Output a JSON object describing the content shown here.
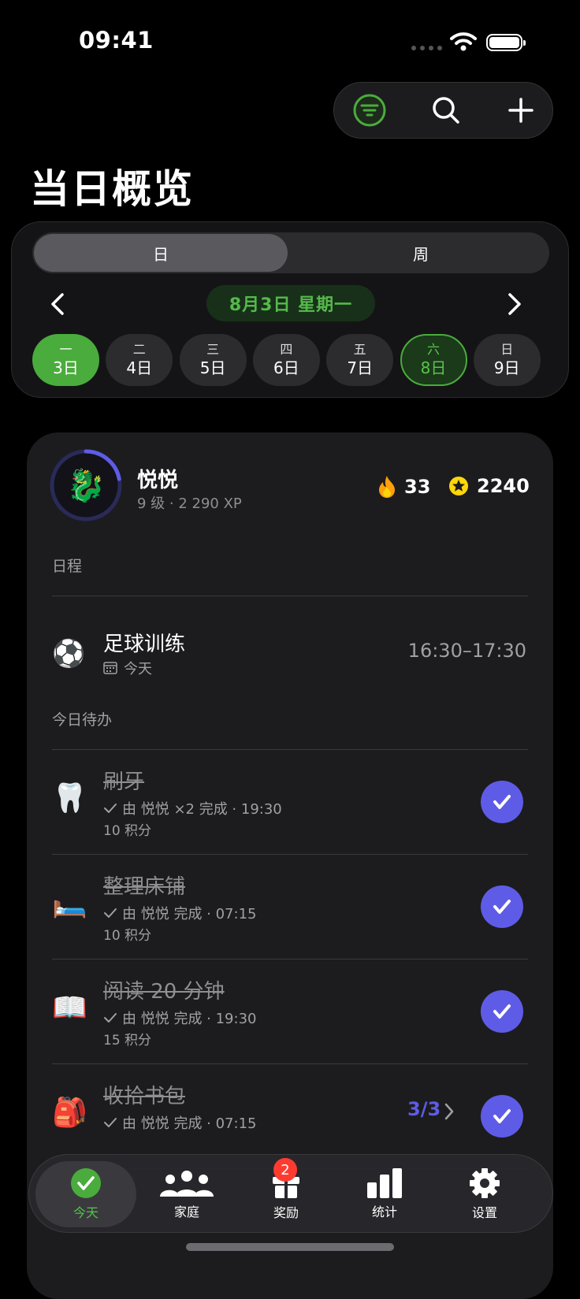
{
  "status_bar": {
    "time": "09:41"
  },
  "page": {
    "title": "当日概览"
  },
  "segment": {
    "day": "日",
    "week": "周"
  },
  "date_header": "8月3日 星期一",
  "week_days": [
    {
      "weekday": "一",
      "date": "3日",
      "state": "selected"
    },
    {
      "weekday": "二",
      "date": "4日",
      "state": "normal"
    },
    {
      "weekday": "三",
      "date": "5日",
      "state": "normal"
    },
    {
      "weekday": "四",
      "date": "6日",
      "state": "normal"
    },
    {
      "weekday": "五",
      "date": "7日",
      "state": "normal"
    },
    {
      "weekday": "六",
      "date": "8日",
      "state": "today"
    },
    {
      "weekday": "日",
      "date": "9日",
      "state": "normal"
    }
  ],
  "user": {
    "name": "悦悦",
    "level": "9 级 · 2 290 XP",
    "avatar": "🐉",
    "streak": "33",
    "coins": "2240",
    "level_progress": 0.22
  },
  "schedule": {
    "label": "日程",
    "event": {
      "icon": "⚽",
      "title": "足球训练",
      "date": "今天",
      "time": "16:30–17:30"
    }
  },
  "todo": {
    "label": "今日待办",
    "tasks": [
      {
        "icon": "🦷",
        "name": "刷牙",
        "detail": "由 悦悦 ×2 完成 · 19:30",
        "points": "10 积分"
      },
      {
        "icon": "🛏️",
        "name": "整理床铺",
        "detail": "由 悦悦 完成 · 07:15",
        "points": "10 积分"
      },
      {
        "icon": "📖",
        "name": "阅读 20 分钟",
        "detail": "由 悦悦 完成 · 19:30",
        "points": "15 积分"
      },
      {
        "icon": "🎒",
        "name": "收拾书包",
        "detail": "由 悦悦 完成 · 07:15",
        "points": "",
        "progress": "3/3"
      }
    ]
  },
  "tabs": [
    {
      "label": "今天",
      "icon": "check-circle-icon"
    },
    {
      "label": "家庭",
      "icon": "people-icon"
    },
    {
      "label": "奖励",
      "icon": "gift-icon"
    },
    {
      "label": "统计",
      "icon": "bar-chart-icon"
    },
    {
      "label": "设置",
      "icon": "gear-icon"
    }
  ],
  "reward_badge": "2",
  "colors": {
    "accent_green": "#4aac3c",
    "accent_purple": "#5e5ce6",
    "background": "#000000",
    "card": "#1c1c1e"
  }
}
